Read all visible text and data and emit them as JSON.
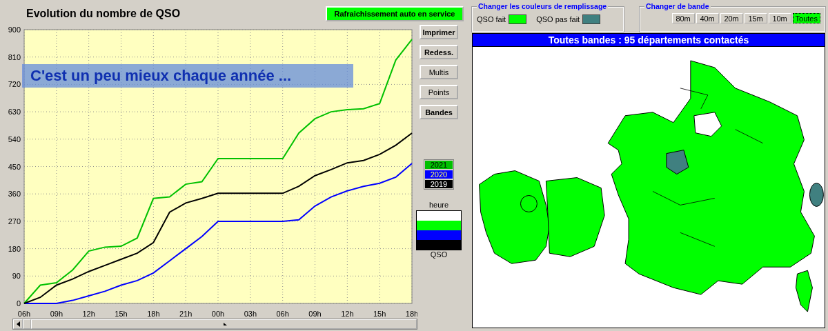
{
  "chart_panel": {
    "title": "Evolution du nombre de QSO",
    "auto_refresh_button": "Rafraichissement auto en service",
    "chart_data": {
      "type": "line",
      "categories": [
        "06h",
        null,
        "09h",
        null,
        "12h",
        null,
        "15h",
        null,
        "18h",
        null,
        "21h",
        null,
        "00h",
        null,
        "03h",
        null,
        "06h",
        null,
        "09h",
        null,
        "12h",
        null,
        "15h",
        null,
        "18h"
      ],
      "ylim": [
        0,
        900
      ],
      "grid": true,
      "yticks": [
        0,
        90,
        180,
        270,
        360,
        450,
        540,
        630,
        720,
        810,
        900
      ],
      "series": [
        {
          "name": "2021",
          "color": "#00c000",
          "values": [
            0,
            60,
            68,
            110,
            172,
            185,
            188,
            215,
            345,
            350,
            392,
            400,
            476,
            476,
            476,
            476,
            476,
            560,
            607,
            630,
            637,
            640,
            657,
            800,
            868
          ]
        },
        {
          "name": "2020",
          "color": "#0000ff",
          "values": [
            0,
            0,
            0,
            10,
            25,
            40,
            60,
            75,
            100,
            140,
            180,
            220,
            270,
            270,
            270,
            270,
            270,
            275,
            320,
            350,
            370,
            385,
            395,
            415,
            460
          ]
        },
        {
          "name": "2019",
          "color": "#000000",
          "values": [
            0,
            20,
            60,
            80,
            105,
            125,
            145,
            165,
            200,
            300,
            330,
            345,
            362,
            362,
            362,
            362,
            362,
            385,
            420,
            440,
            462,
            470,
            490,
            520,
            560
          ]
        }
      ],
      "annotations": [
        {
          "text": "C'est un peu mieux chaque année ..."
        }
      ]
    },
    "buttons": [
      {
        "label": "Imprimer",
        "bold": true
      },
      {
        "label": "Redess.",
        "bold": true
      },
      {
        "label": "Multis",
        "bold": false
      },
      {
        "label": "Points",
        "bold": false
      },
      {
        "label": "Bandes",
        "bold": true
      }
    ],
    "legend_scale": {
      "top_label": "heure",
      "bottom_label": "QSO",
      "bands": [
        {
          "color": "#ffffff"
        },
        {
          "color": "#00ff00"
        },
        {
          "color": "#0000ff"
        },
        {
          "color": "#000000"
        }
      ]
    }
  },
  "map_panel": {
    "fill_colors": {
      "title": "Changer les couleurs de remplissage",
      "items": [
        {
          "label": "QSO fait",
          "color": "#00ff00"
        },
        {
          "label": "QSO pas fait",
          "color": "#408080"
        }
      ]
    },
    "band_selector": {
      "title": "Changer de bande",
      "bands": [
        {
          "label": "80m",
          "selected": false
        },
        {
          "label": "40m",
          "selected": false
        },
        {
          "label": "20m",
          "selected": false
        },
        {
          "label": "15m",
          "selected": false
        },
        {
          "label": "10m",
          "selected": false
        },
        {
          "label": "Toutes",
          "selected": true
        }
      ]
    },
    "header": "Toutes bandes :  95 départements contactés"
  }
}
